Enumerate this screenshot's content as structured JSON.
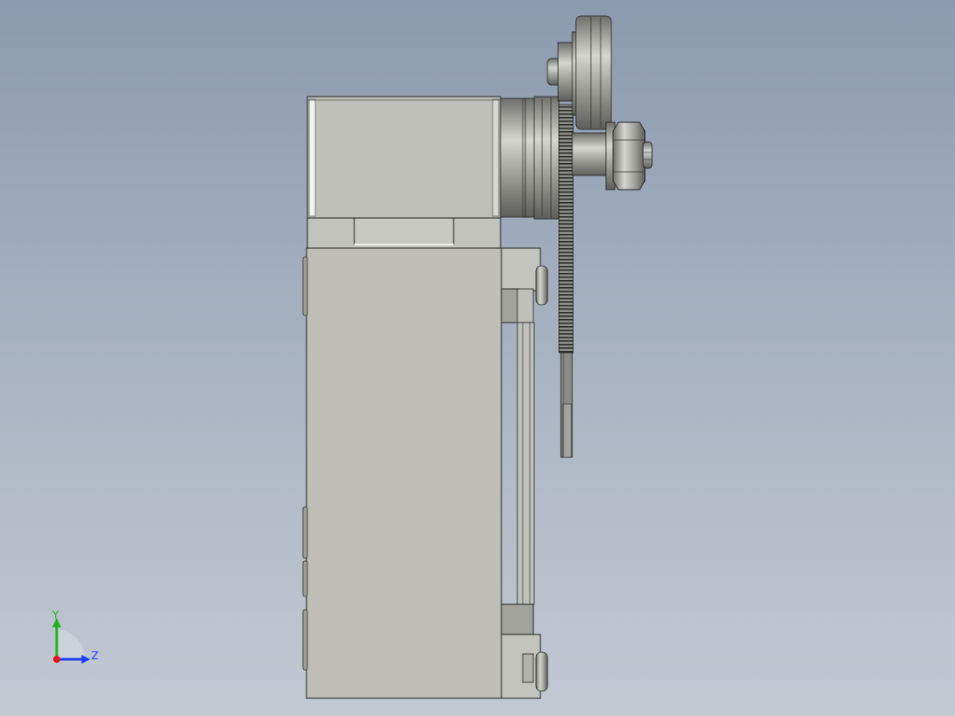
{
  "viewport": {
    "background_top": "#8b9aae",
    "background_bottom": "#c3c9d3"
  },
  "model": {
    "part_color": "#bfbfb8",
    "edge_color": "#222222",
    "metal_color": "#a9a9a4"
  },
  "triad": {
    "y_label": "Y",
    "z_label": "Z",
    "y_color": "#1db31d",
    "z_color": "#1f3fff",
    "x_color": "#e01818"
  }
}
